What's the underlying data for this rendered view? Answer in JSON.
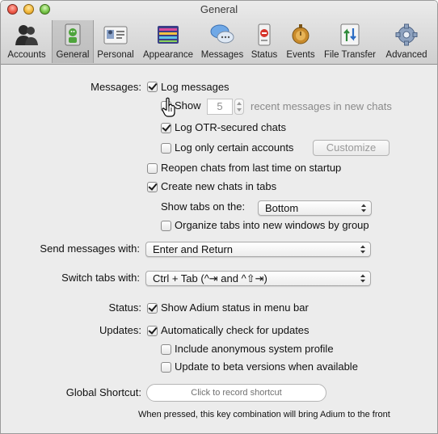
{
  "window": {
    "title": "General"
  },
  "toolbar": {
    "items": [
      {
        "label": "Accounts",
        "icon": "accounts-icon",
        "selected": false
      },
      {
        "label": "General",
        "icon": "general-icon",
        "selected": true
      },
      {
        "label": "Personal",
        "icon": "personal-icon",
        "selected": false
      },
      {
        "label": "Appearance",
        "icon": "appearance-icon",
        "selected": false
      },
      {
        "label": "Messages",
        "icon": "messages-icon",
        "selected": false
      },
      {
        "label": "Status",
        "icon": "status-icon",
        "selected": false
      },
      {
        "label": "Events",
        "icon": "events-icon",
        "selected": false
      },
      {
        "label": "File Transfer",
        "icon": "file-transfer-icon",
        "selected": false
      },
      {
        "label": "Advanced",
        "icon": "advanced-icon",
        "selected": false
      }
    ]
  },
  "messages": {
    "label": "Messages:",
    "log_messages": {
      "label": "Log messages",
      "checked": true
    },
    "show_recent": {
      "label": "Show",
      "checked": false,
      "value": "5",
      "suffix": "recent messages in new chats"
    },
    "log_otr": {
      "label": "Log OTR-secured chats",
      "checked": true
    },
    "log_certain": {
      "label": "Log only certain accounts",
      "checked": false
    },
    "customize_button": "Customize",
    "reopen_chats": {
      "label": "Reopen chats from last time on startup",
      "checked": false
    },
    "create_tabs": {
      "label": "Create new chats in tabs",
      "checked": true
    },
    "show_tabs_on": {
      "label": "Show tabs on the:",
      "value": "Bottom"
    },
    "organize_tabs": {
      "label": "Organize tabs into new windows by group",
      "checked": false
    }
  },
  "send_messages": {
    "label": "Send messages with:",
    "value": "Enter and Return"
  },
  "switch_tabs": {
    "label": "Switch tabs with:",
    "value": "Ctrl + Tab (^⇥ and ^⇧⇥)"
  },
  "status": {
    "label": "Status:",
    "show_in_menu_bar": {
      "label": "Show Adium status in menu bar",
      "checked": true
    }
  },
  "updates": {
    "label": "Updates:",
    "auto_check": {
      "label": "Automatically check for updates",
      "checked": true
    },
    "anonymous_profile": {
      "label": "Include anonymous system profile",
      "checked": false
    },
    "beta_versions": {
      "label": "Update to beta versions when available",
      "checked": false
    }
  },
  "global_shortcut": {
    "label": "Global Shortcut:",
    "placeholder": "Click to record shortcut",
    "hint": "When pressed, this key combination will bring Adium to the front"
  },
  "colors": {
    "check": "#1a1a1a",
    "window_bg": "#ececec"
  }
}
